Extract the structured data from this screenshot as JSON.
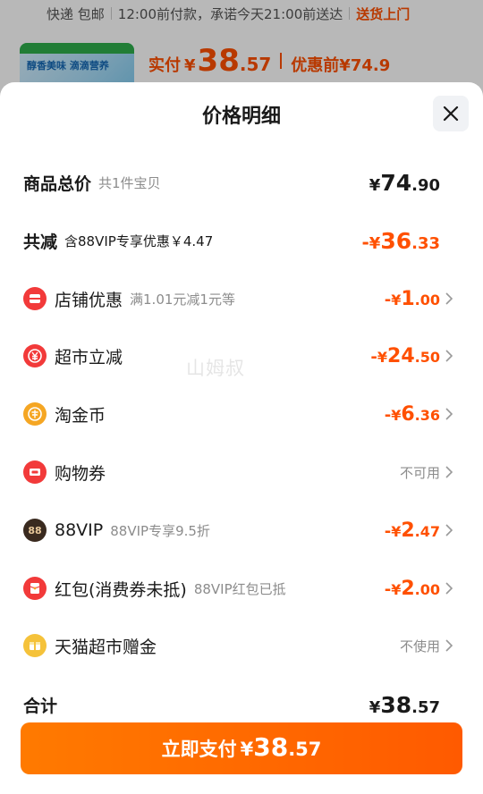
{
  "background_page": {
    "delivery": {
      "text1": "快递 包邮",
      "text2": "12:00前付款，承诺今天21:00前送达",
      "text3": "送货上门"
    },
    "product": {
      "thumb_slogan": "醇香美味 滴滴营养",
      "paid_label": "实付",
      "paid_currency": "¥",
      "paid_int": "38",
      "paid_dec": ".57",
      "pre_discount_label": "优惠前",
      "pre_discount_value": "¥74.9"
    }
  },
  "sheet": {
    "title": "价格明细",
    "close_glyph": "✕",
    "watermark": "山姆叔"
  },
  "rows": [
    {
      "label": "商品总价",
      "sub": "共1件宝贝",
      "minus": "",
      "currency": "¥",
      "int": "74",
      "dec": ".90"
    },
    {
      "label": "共减",
      "sub": "含88VIP专享优惠￥4.47",
      "minus": "-",
      "currency": "¥",
      "int": "36",
      "dec": ".33"
    },
    {
      "label": "店铺优惠",
      "sub": "满1.01元减1元等",
      "minus": "-",
      "currency": "¥",
      "int": "1",
      "dec": ".00",
      "icon": "store-coupon-icon",
      "icon_color": "#f23a3a"
    },
    {
      "label": "超市立减",
      "sub": "",
      "minus": "-",
      "currency": "¥",
      "int": "24",
      "dec": ".50",
      "icon": "yuan-coin-icon",
      "icon_color": "#f23a3a"
    },
    {
      "label": "淘金币",
      "sub": "",
      "minus": "-",
      "currency": "¥",
      "int": "6",
      "dec": ".36",
      "icon": "gold-coin-icon",
      "icon_color": "#f5a623"
    },
    {
      "label": "购物券",
      "sub": "",
      "value_text": "不可用",
      "icon": "shopping-voucher-icon",
      "icon_color": "#f23a3a"
    },
    {
      "label": "88VIP",
      "sub": "88VIP专享9.5折",
      "minus": "-",
      "currency": "¥",
      "int": "2",
      "dec": ".47",
      "icon": "88vip-icon",
      "icon_color": "#3a2a1f",
      "icon_text": "88"
    },
    {
      "label": "红包(消费券未抵)",
      "sub": "88VIP红包已抵",
      "minus": "-",
      "currency": "¥",
      "int": "2",
      "dec": ".00",
      "icon": "red-packet-icon",
      "icon_color": "#f23a3a"
    },
    {
      "label": "天猫超市赠金",
      "sub": "",
      "value_text": "不使用",
      "icon": "gift-money-icon",
      "icon_color": "#f5c23a"
    }
  ],
  "total": {
    "label": "合计",
    "currency": "¥",
    "int": "38",
    "dec": ".57"
  },
  "pay_button": {
    "label": "立即支付",
    "currency": "¥",
    "int": "38",
    "dec": ".57"
  },
  "colors": {
    "accent": "#ff5000",
    "muted": "#8c8c8c",
    "text": "#1a1a1a"
  }
}
